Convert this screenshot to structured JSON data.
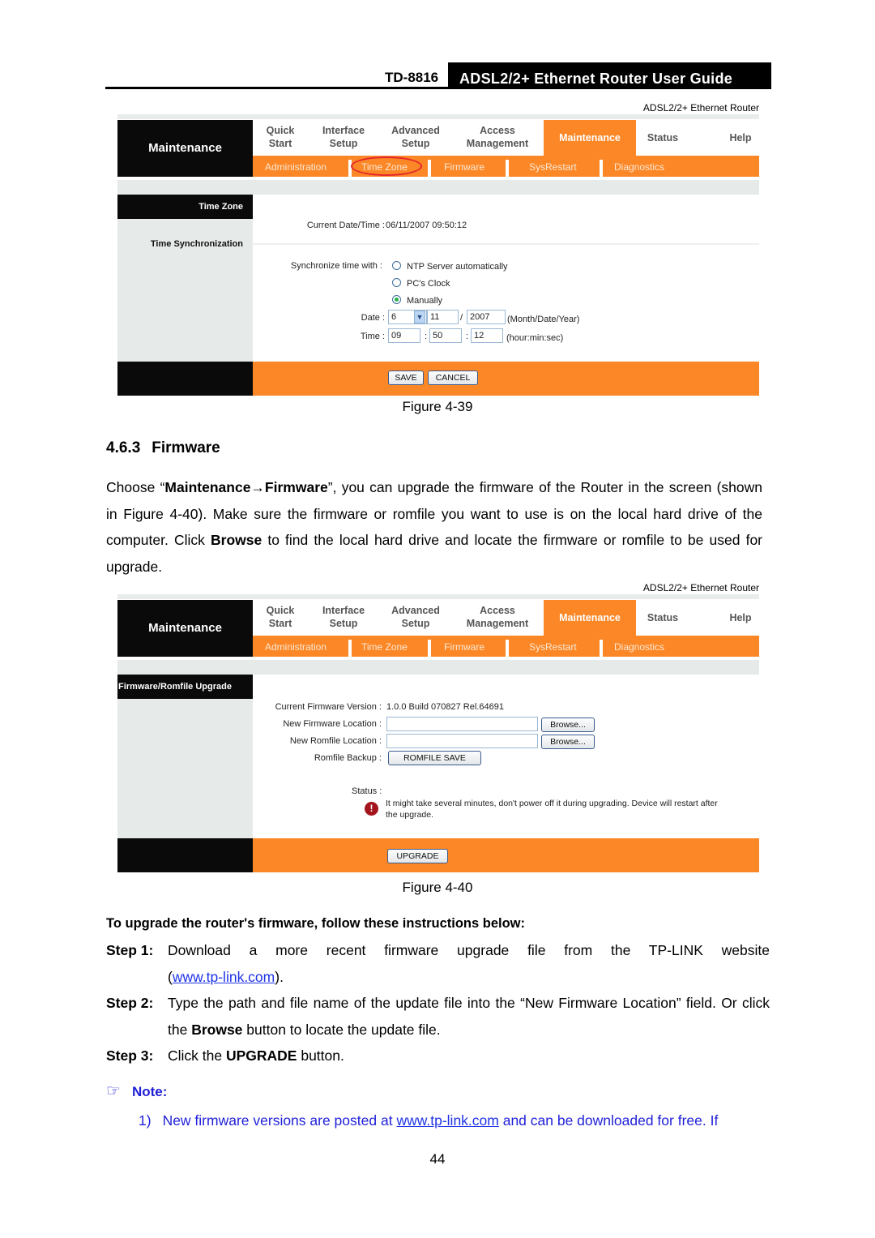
{
  "header": {
    "model": "TD-8816",
    "guide_title": "ADSL2/2+ Ethernet Router User Guide"
  },
  "router": {
    "brand": "ADSL2/2+ Ethernet Router",
    "section_title": "Maintenance",
    "menu": [
      {
        "line1": "Quick",
        "line2": "Start"
      },
      {
        "line1": "Interface",
        "line2": "Setup"
      },
      {
        "line1": "Advanced",
        "line2": "Setup"
      },
      {
        "line1": "Access",
        "line2": "Management"
      },
      {
        "line1": "Maintenance",
        "line2": "",
        "active": true
      },
      {
        "line1": "Status",
        "line2": ""
      },
      {
        "line1": "Help",
        "line2": ""
      }
    ],
    "submenu": [
      "Administration",
      "Time Zone",
      "Firmware",
      "SysRestart",
      "Diagnostics"
    ],
    "colors": {
      "orange": "#fb8726",
      "black": "#0a0a0a",
      "gray": "#e6eae9",
      "highlight": "#e5262b"
    }
  },
  "figure39": {
    "highlighted_submenu": "Time Zone",
    "sidebar_head": "Time Zone",
    "sidebar_label": "Time Synchronization",
    "current_label": "Current Date/Time :",
    "current_value": "06/11/2007 09:50:12",
    "sync_label": "Synchronize time with :",
    "sync_options": [
      {
        "label": "NTP Server automatically",
        "selected": false
      },
      {
        "label": "PC's Clock",
        "selected": false
      },
      {
        "label": "Manually",
        "selected": true
      }
    ],
    "date_label": "Date :",
    "date_month": "6",
    "date_day": "11",
    "date_sep": "/",
    "date_year": "2007",
    "date_hint": "(Month/Date/Year)",
    "time_label": "Time :",
    "time_hour": "09",
    "time_min": "50",
    "time_sec": "12",
    "time_sep": ":",
    "time_hint": "(hour:min:sec)",
    "save": "SAVE",
    "cancel": "CANCEL",
    "caption": "Figure 4-39"
  },
  "section": {
    "number": "4.6.3",
    "title": "Firmware",
    "intro_prefix": "Choose “",
    "intro_bold1": "Maintenance→Firmware",
    "intro_mid": "”, you can upgrade the firmware of the Router in the screen (shown in Figure 4-40). Make sure the firmware or romfile you want to use is on the local hard drive of the computer. Click ",
    "intro_bold2": "Browse",
    "intro_suffix": " to find the local hard drive and locate the firmware or romfile to be used for upgrade."
  },
  "figure40": {
    "sidebar_head": "Firmware/Romfile Upgrade",
    "current_fw_label": "Current Firmware Version :",
    "current_fw_value": "1.0.0 Build 070827 Rel.64691",
    "new_fw_label": "New Firmware Location :",
    "new_fw_value": "",
    "new_rom_label": "New Romfile Location :",
    "new_rom_value": "",
    "browse": "Browse...",
    "rom_backup_label": "Romfile Backup :",
    "rom_save": "ROMFILE SAVE",
    "status_label": "Status :",
    "status_msg_line1": "It might take several minutes, don't power off it during upgrading. Device will restart after",
    "status_msg_line2": "the upgrade.",
    "upgrade": "UPGRADE",
    "caption": "Figure 4-40"
  },
  "instructions": {
    "heading": "To upgrade the router's firmware, follow these instructions below:",
    "steps": [
      {
        "label": "Step 1:",
        "text": "Download a more recent firmware upgrade file from the TP-LINK website",
        "link": "www.tp-link.com"
      },
      {
        "label": "Step 2:",
        "text_a": "Type the path and file name of the update file into the “New Firmware Location” field. Or click the ",
        "bold": "Browse",
        "text_b": " button to locate the update file."
      },
      {
        "label": "Step 3:",
        "text_a": "Click the ",
        "bold": "UPGRADE",
        "text_b": " button."
      }
    ]
  },
  "note": {
    "label": "Note:",
    "items": [
      {
        "num": "1)",
        "text_a": "New firmware versions are posted at ",
        "link": "www.tp-link.com",
        "text_b": " and can be downloaded for free. If"
      }
    ]
  },
  "page_number": "44"
}
